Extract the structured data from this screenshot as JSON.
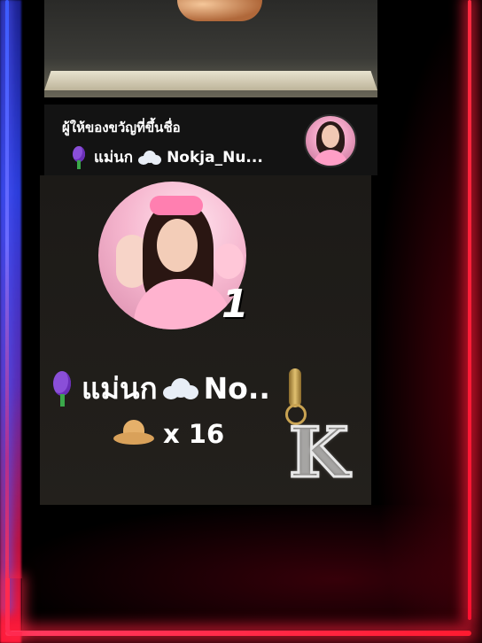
{
  "gifter_bar": {
    "title": "ผู้ให้ของขวัญที่ขึ้นชื่อ",
    "user_name": "แม่นก",
    "user_name_suffix": "Nokja_Nu..."
  },
  "leader": {
    "rank": "1",
    "name_prefix": "แม่นก",
    "name_suffix": "No..",
    "gift_count": "x 16"
  },
  "pendant": {
    "letter": "K"
  },
  "colors": {
    "neon_blue": "#3b5bff",
    "neon_red": "#ff1a30",
    "panel": "#1c1a17"
  },
  "icons": [
    "hyacinth-icon",
    "cloud-icon",
    "cowboy-hat-icon"
  ]
}
